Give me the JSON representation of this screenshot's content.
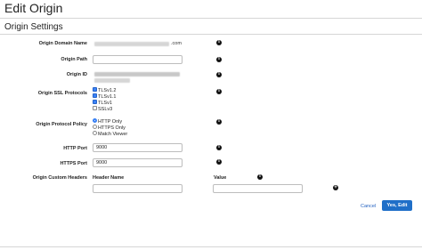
{
  "page": {
    "title": "Edit Origin",
    "section_title": "Origin Settings"
  },
  "fields": {
    "origin_domain_name": {
      "label": "Origin Domain Name",
      "value_suffix": ".com"
    },
    "origin_path": {
      "label": "Origin Path",
      "value": ""
    },
    "origin_id": {
      "label": "Origin ID"
    },
    "origin_ssl_protocols": {
      "label": "Origin SSL Protocols",
      "options": [
        {
          "label": "TLSv1.2",
          "checked": true
        },
        {
          "label": "TLSv1.1",
          "checked": true
        },
        {
          "label": "TLSv1",
          "checked": true
        },
        {
          "label": "SSLv3",
          "checked": false
        }
      ]
    },
    "origin_protocol_policy": {
      "label": "Origin Protocol Policy",
      "options": [
        {
          "label": "HTTP Only",
          "selected": true
        },
        {
          "label": "HTTPS Only",
          "selected": false
        },
        {
          "label": "Match Viewer",
          "selected": false
        }
      ]
    },
    "http_port": {
      "label": "HTTP Port",
      "value": "9000"
    },
    "https_port": {
      "label": "HTTPS Port",
      "value": "9000"
    },
    "origin_custom_headers": {
      "label": "Origin Custom Headers",
      "header_name_col": "Header Name",
      "value_col": "Value",
      "header_name_value": "",
      "value_value": ""
    }
  },
  "icons": {
    "info": "info-icon",
    "add": "plus-circle-icon"
  },
  "actions": {
    "cancel_label": "Cancel",
    "submit_label": "Yes, Edit"
  },
  "colors": {
    "accent": "#1f6fc8",
    "link": "#1f5fbf"
  }
}
